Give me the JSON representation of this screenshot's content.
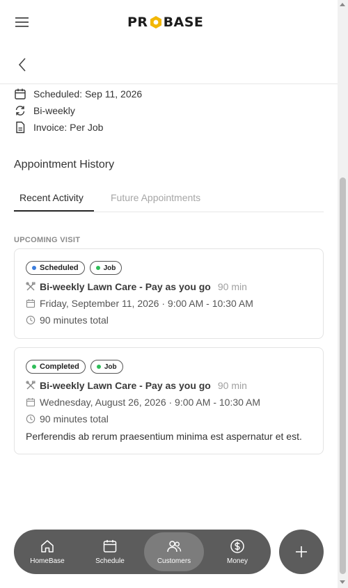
{
  "header": {
    "logo_left": "PR",
    "logo_right": "BASE"
  },
  "details": {
    "scheduled": "Scheduled: Sep 11, 2026",
    "frequency": "Bi-weekly",
    "invoice": "Invoice: Per Job"
  },
  "history": {
    "title": "Appointment History",
    "tabs": [
      {
        "label": "Recent Activity",
        "active": true
      },
      {
        "label": "Future Appointments",
        "active": false
      }
    ],
    "upcoming_label": "UPCOMING VISIT"
  },
  "cards": [
    {
      "status": "Scheduled",
      "status_color": "#3b7ddd",
      "type": "Job",
      "type_color": "#2ebd59",
      "title": "Bi-weekly Lawn Care - Pay as you go",
      "duration": "90 min",
      "date": "Friday, September 11, 2026 · 9:00 AM - 10:30 AM",
      "total": "90 minutes total"
    },
    {
      "status": "Completed",
      "status_color": "#2ebd59",
      "type": "Job",
      "type_color": "#2ebd59",
      "title": "Bi-weekly Lawn Care - Pay as you go",
      "duration": "90 min",
      "date": "Wednesday, August 26, 2026 · 9:00 AM - 10:30 AM",
      "total": "90 minutes total",
      "note": "Perferendis ab rerum praesentium minima est aspernatur et est."
    }
  ],
  "nav": {
    "items": [
      {
        "label": "HomeBase",
        "icon": "home-icon"
      },
      {
        "label": "Schedule",
        "icon": "calendar-icon"
      },
      {
        "label": "Customers",
        "icon": "users-icon",
        "active": true
      },
      {
        "label": "Money",
        "icon": "dollar-icon"
      }
    ]
  },
  "colors": {
    "brand_accent": "#f2b705",
    "nav_bg": "#5c5c5c",
    "nav_active": "#7c7c7c"
  }
}
